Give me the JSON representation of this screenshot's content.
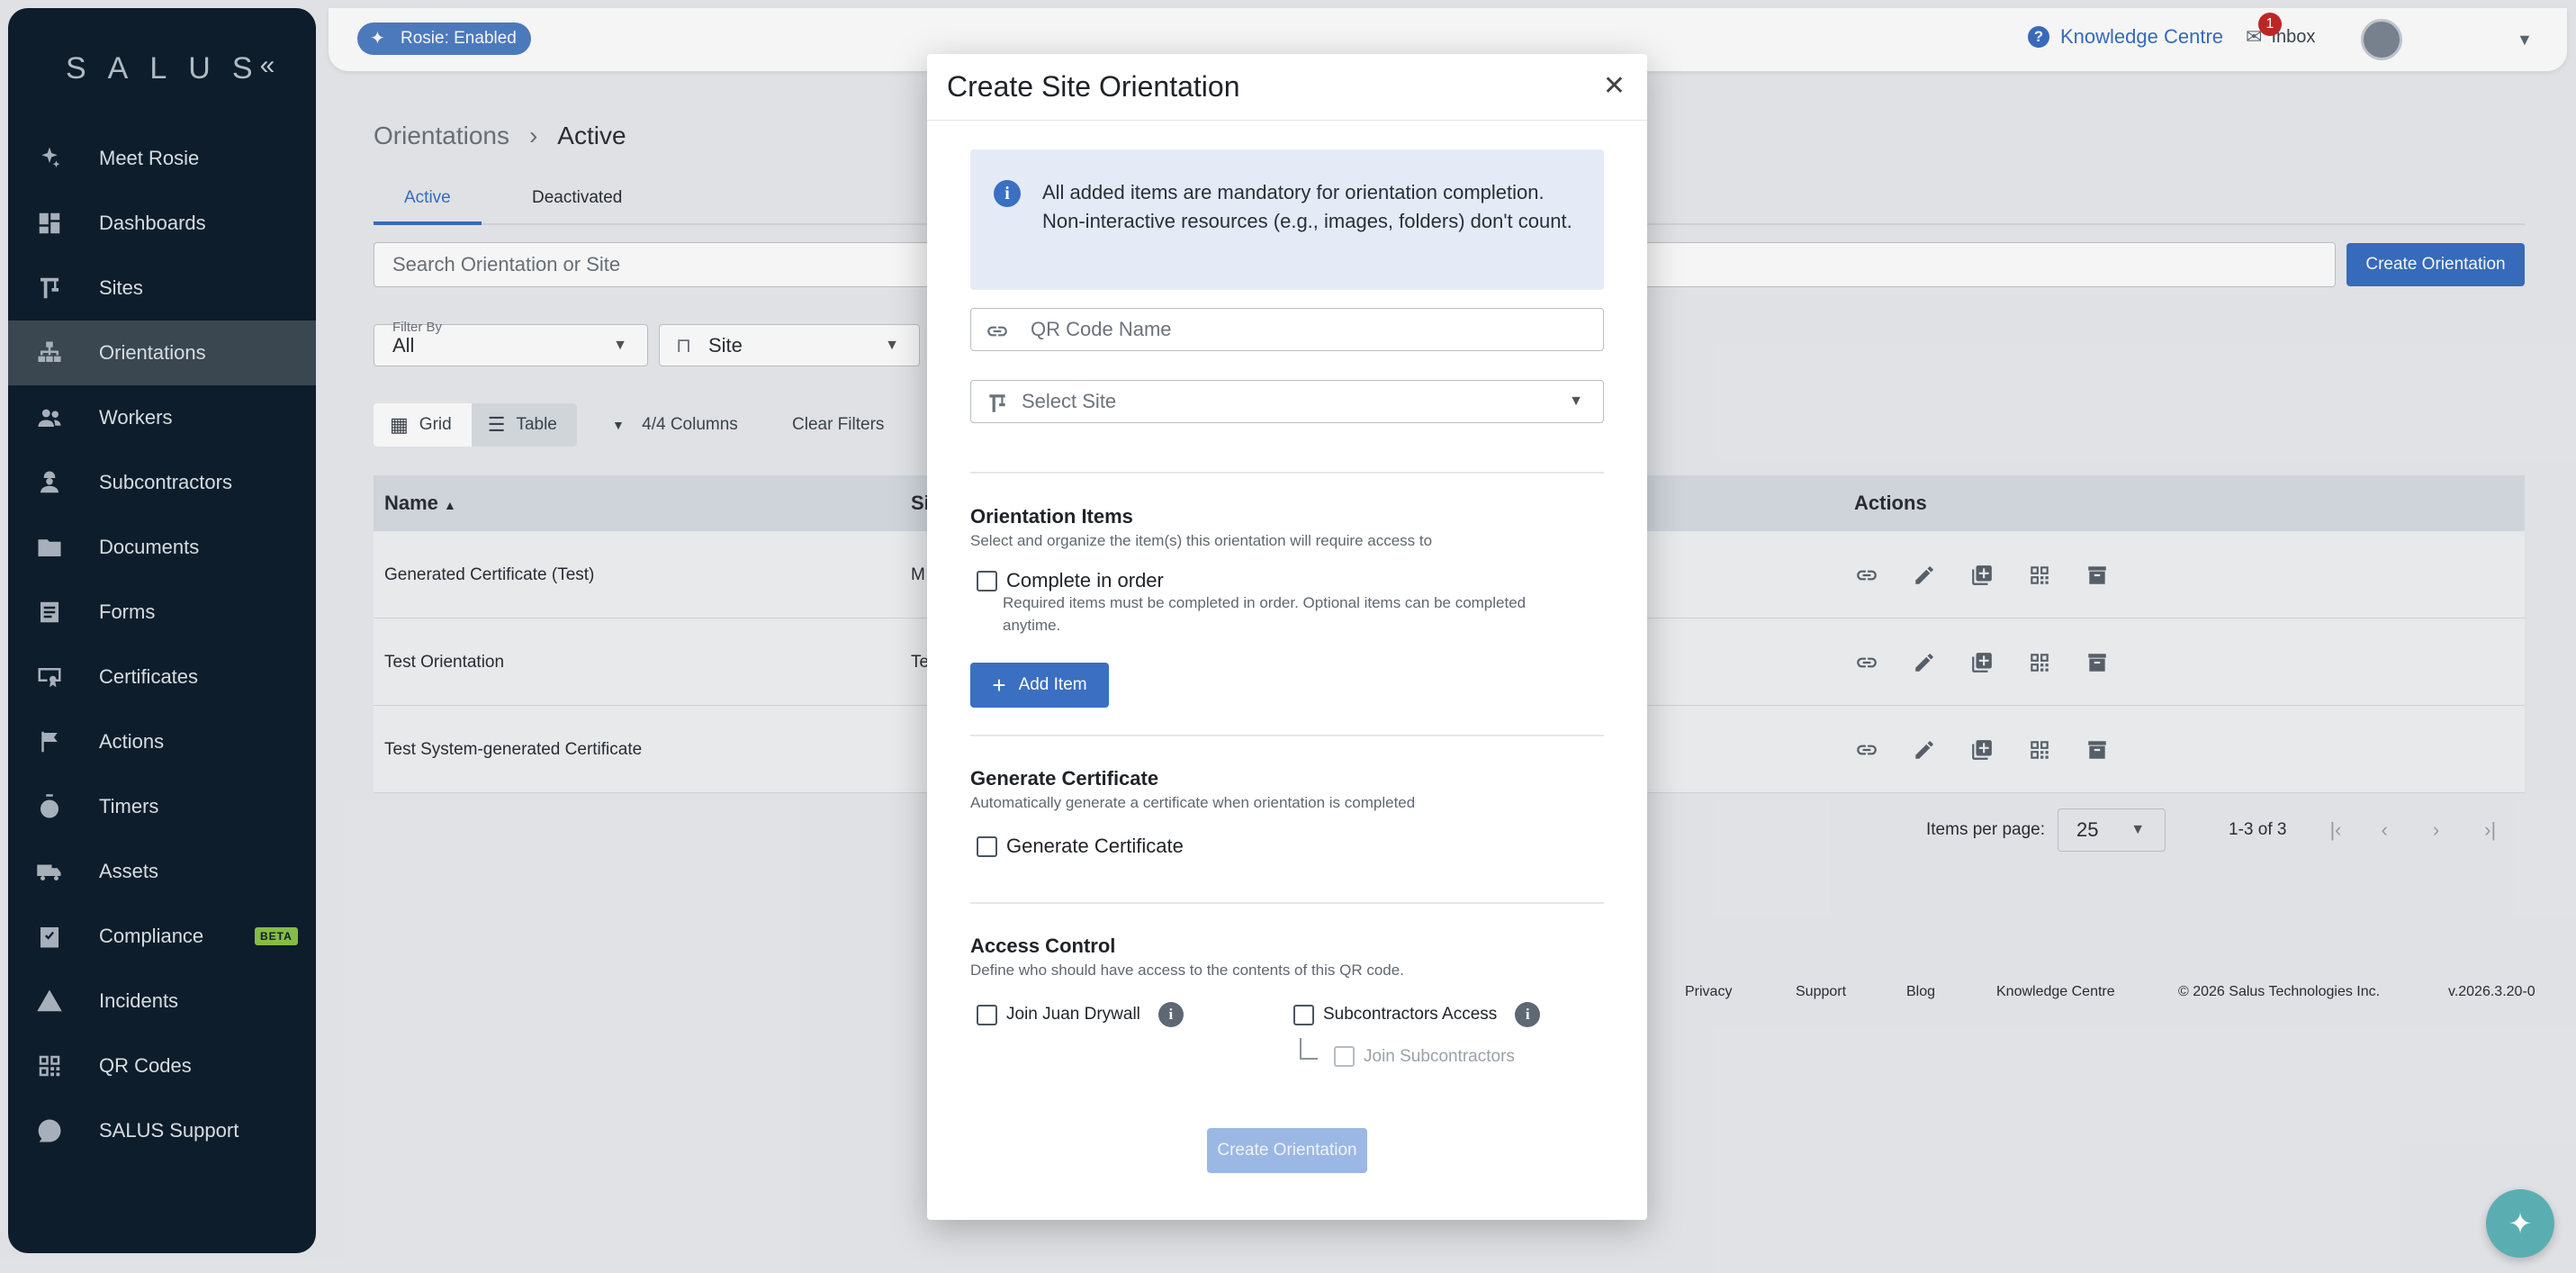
{
  "sidebar": {
    "logo": "SALUS",
    "collapse_icon": "«",
    "items": [
      {
        "label": "Meet Rosie",
        "icon": "sparkle-icon"
      },
      {
        "label": "Dashboards",
        "icon": "dashboard-icon"
      },
      {
        "label": "Sites",
        "icon": "crane-icon"
      },
      {
        "label": "Orientations",
        "icon": "hierarchy-icon",
        "active": true
      },
      {
        "label": "Workers",
        "icon": "people-icon"
      },
      {
        "label": "Subcontractors",
        "icon": "worker-icon"
      },
      {
        "label": "Documents",
        "icon": "folder-icon"
      },
      {
        "label": "Forms",
        "icon": "form-icon"
      },
      {
        "label": "Certificates",
        "icon": "certificate-icon"
      },
      {
        "label": "Actions",
        "icon": "flag-icon"
      },
      {
        "label": "Timers",
        "icon": "stopwatch-icon"
      },
      {
        "label": "Assets",
        "icon": "truck-icon"
      },
      {
        "label": "Compliance",
        "icon": "clipboard-check-icon",
        "badge": "BETA"
      },
      {
        "label": "Incidents",
        "icon": "warning-icon"
      },
      {
        "label": "QR Codes",
        "icon": "qr-icon"
      },
      {
        "label": "SALUS Support",
        "icon": "support-icon"
      }
    ]
  },
  "topbar": {
    "rosie_chip": "Rosie: Enabled",
    "knowledge_centre": "Knowledge Centre",
    "inbox_label": "Inbox",
    "inbox_count": "1"
  },
  "main": {
    "breadcrumb_root": "Orientations",
    "breadcrumb_sep": "›",
    "breadcrumb_current": "Active",
    "tabs": [
      "Active",
      "Deactivated"
    ],
    "search_placeholder": "Search Orientation or Site",
    "create_button": "Create Orientation",
    "filter_label": "Filter By",
    "filter_value": "All",
    "site_filter": "Site",
    "view_grid": "Grid",
    "view_table": "Table",
    "columns_label": "4/4 Columns",
    "clear_filters": "Clear Filters",
    "table_headers": {
      "name": "Name",
      "site_partial": "Si",
      "actions": "Actions"
    },
    "rows": [
      {
        "name": "Generated Certificate (Test)",
        "site_partial": "M"
      },
      {
        "name": "Test Orientation",
        "site_partial": "Te"
      },
      {
        "name": "Test System-generated Certificate",
        "site_partial": ""
      }
    ],
    "items_per_page_label": "Items per page:",
    "items_per_page_value": "25",
    "range": "1-3 of 3",
    "footer": {
      "privacy": "Privacy",
      "support": "Support",
      "blog": "Blog",
      "kc": "Knowledge Centre",
      "copyright": "© 2026 Salus Technologies Inc.",
      "version": "v.2026.3.20-0"
    }
  },
  "modal": {
    "title": "Create Site Orientation",
    "info": "All added items are mandatory for orientation completion. Non-interactive resources (e.g., images, folders) don't count.",
    "qr_placeholder": "QR Code Name",
    "site_placeholder": "Select Site",
    "orientation_items": {
      "title": "Orientation Items",
      "subtitle": "Select and organize the item(s) this orientation will require access to",
      "complete_in_order": "Complete in order",
      "complete_in_order_help": "Required items must be completed in order. Optional items can be completed anytime.",
      "add_item": "Add Item"
    },
    "generate_certificate": {
      "title": "Generate Certificate",
      "subtitle": "Automatically generate a certificate when orientation is completed",
      "checkbox": "Generate Certificate"
    },
    "access_control": {
      "title": "Access Control",
      "subtitle": "Define who should have access to the contents of this QR code.",
      "join_company": "Join Juan Drywall",
      "subcontractors_access": "Subcontractors Access",
      "join_subcontractors": "Join Subcontractors"
    },
    "submit": "Create Orientation"
  },
  "colors": {
    "sidebar_bg": "#0f1f2d",
    "accent": "#3a6fc2",
    "rosie_chip": "#4f7ec4",
    "beta_badge": "#8bc34a",
    "fab": "#5aaeb2"
  }
}
